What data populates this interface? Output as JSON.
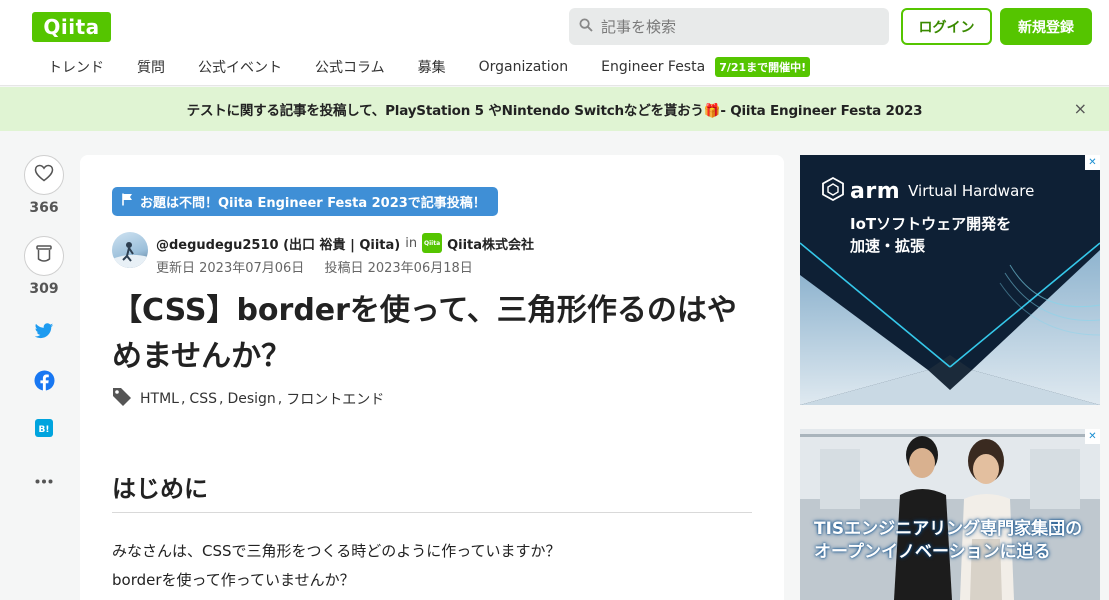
{
  "header": {
    "logo": "Qiita",
    "search_placeholder": "記事を検索",
    "login_label": "ログイン",
    "signup_label": "新規登録",
    "nav": [
      "トレンド",
      "質問",
      "公式イベント",
      "公式コラム",
      "募集",
      "Organization",
      "Engineer Festa"
    ],
    "nav_badge": "7/21まで開催中!"
  },
  "banner": {
    "text": "テストに関する記事を投稿して、PlayStation 5 やNintendo Switchなどを貰おう🎁- Qiita Engineer Festa 2023",
    "close": "×"
  },
  "rail": {
    "likes": "366",
    "stocks": "309"
  },
  "article": {
    "event_tag": "お題は不問！Qiita Engineer Festa 2023で記事投稿！",
    "author": "@degudegu2510 (出口 裕貴 | Qiita)",
    "in_label": "in",
    "org_logo": "Qiita",
    "org": "Qiita株式会社",
    "updated": "更新日 2023年07月06日",
    "posted": "投稿日 2023年06月18日",
    "title": "【CSS】borderを使って、三角形作るのはやめませんか？",
    "tags": [
      "HTML",
      "CSS",
      "Design",
      "フロントエンド"
    ],
    "heading": "はじめに",
    "paragraphs": [
      "みなさんは、CSSで三角形をつくる時どのように作っていますか？",
      "borderを使って作っていませんか？"
    ]
  },
  "ads": {
    "close": "✕",
    "arm_word": "arm",
    "arm_product": "Virtual Hardware",
    "arm_copy": [
      "IoTソフトウェア開発を",
      "加速・拡張"
    ],
    "tis_copy": [
      "TISエンジニアリング専門家集団の",
      "オープンイノベーションに迫る"
    ]
  },
  "colors": {
    "brand_green": "#55c500",
    "banner_bg": "#e0f4d3",
    "event_blue": "#3f8fd6",
    "twitter": "#1d9bf0",
    "facebook": "#1877f2",
    "hatena": "#00a4de"
  },
  "icons": [
    "search-icon",
    "heart-icon",
    "stock-icon",
    "twitter-icon",
    "facebook-icon",
    "hatena-icon",
    "more-icon",
    "flag-icon",
    "tag-icon",
    "close-icon"
  ]
}
